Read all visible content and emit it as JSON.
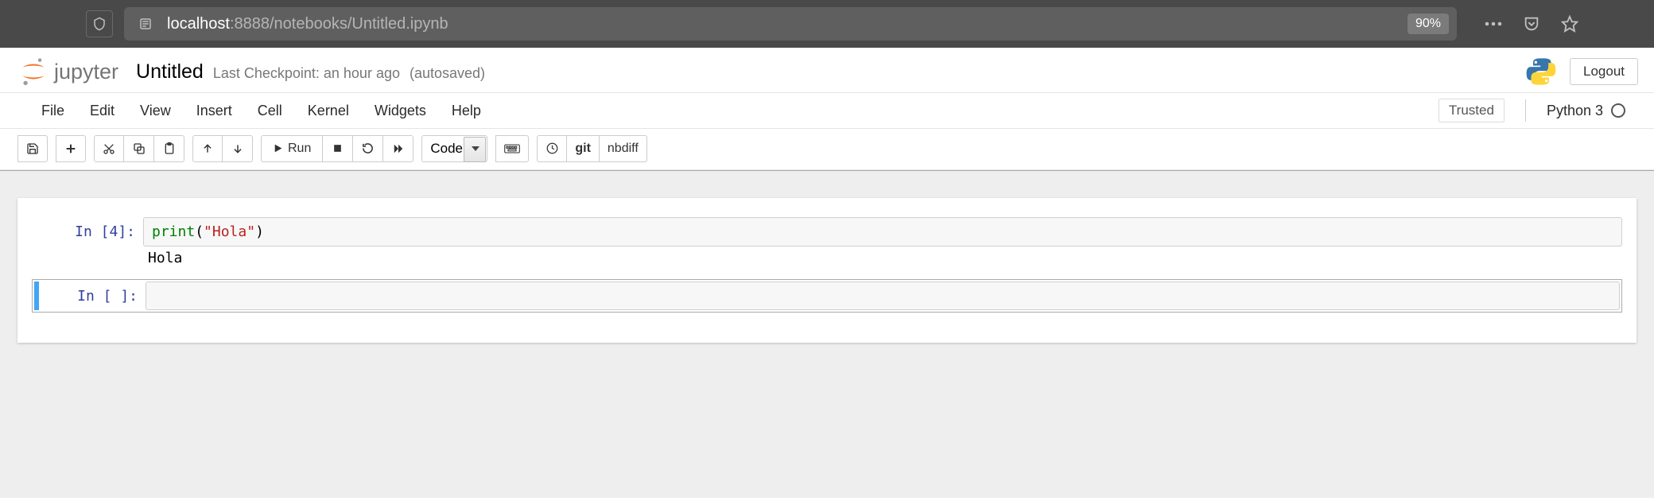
{
  "browser": {
    "host": "localhost",
    "rest": ":8888/notebooks/Untitled.ipynb",
    "zoom": "90%"
  },
  "header": {
    "brand": "jupyter",
    "notebook_name": "Untitled",
    "checkpoint": "Last Checkpoint: an hour ago",
    "autosave": "(autosaved)",
    "logout": "Logout"
  },
  "menubar": {
    "items": [
      "File",
      "Edit",
      "View",
      "Insert",
      "Cell",
      "Kernel",
      "Widgets",
      "Help"
    ],
    "trusted": "Trusted",
    "kernel": "Python 3"
  },
  "toolbar": {
    "run": "Run",
    "celltype": "Code",
    "git": "git",
    "nbdiff": "nbdiff"
  },
  "cells": [
    {
      "prompt": "In [4]:",
      "code_print": "print",
      "code_paren_open": "(",
      "code_str": "\"Hola\"",
      "code_paren_close": ")",
      "output": "Hola"
    },
    {
      "prompt": "In [ ]:"
    }
  ]
}
